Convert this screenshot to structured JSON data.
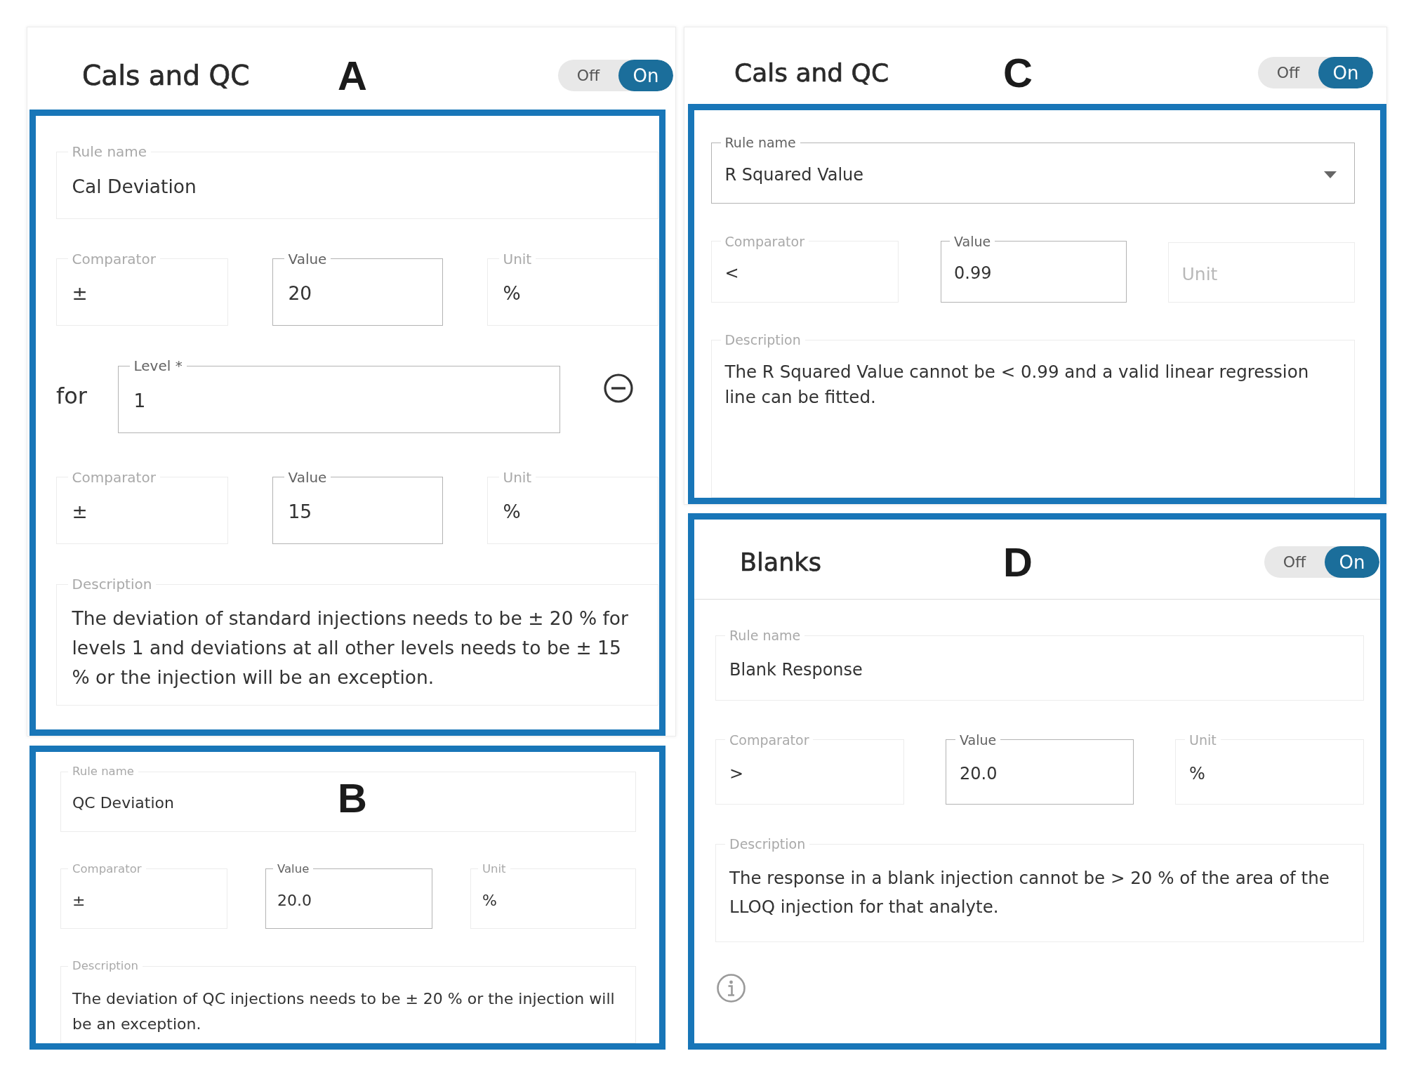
{
  "panels": [
    {
      "letter": "A",
      "kind": "card",
      "title": "Cals and QC",
      "toggle": {
        "off_label": "Off",
        "on_label": "On",
        "on": true
      },
      "rule": {
        "name": {
          "kind": "text",
          "label": "Rule name",
          "value": "Cal Deviation",
          "disabled": true
        },
        "rows": [
          {
            "kind": "condition",
            "fields": [
              {
                "label": "Comparator",
                "value": "±",
                "disabled": true
              },
              {
                "label": "Value",
                "value": "20",
                "disabled": false
              },
              {
                "label": "Unit",
                "value": "%",
                "disabled": true
              }
            ]
          },
          {
            "kind": "level",
            "prefix": "for",
            "removable": true,
            "field": {
              "label": "Level *",
              "value": "1",
              "disabled": false
            }
          },
          {
            "kind": "condition",
            "fields": [
              {
                "label": "Comparator",
                "value": "±",
                "disabled": true
              },
              {
                "label": "Value",
                "value": "15",
                "disabled": false
              },
              {
                "label": "Unit",
                "value": "%",
                "disabled": true
              }
            ]
          }
        ],
        "description": {
          "label": "Description",
          "value": "The deviation of standard injections needs to be ± 20 % for levels 1 and deviations at all other levels needs to be ± 15 % or the injection will be an exception.",
          "disabled": true
        }
      }
    },
    {
      "letter": "B",
      "kind": "card",
      "rule": {
        "name": {
          "kind": "text",
          "label": "Rule name",
          "value": "QC Deviation",
          "disabled": true
        },
        "rows": [
          {
            "kind": "condition",
            "fields": [
              {
                "label": "Comparator",
                "value": "±",
                "disabled": true
              },
              {
                "label": "Value",
                "value": "20.0",
                "disabled": false
              },
              {
                "label": "Unit",
                "value": "%",
                "disabled": true
              }
            ]
          }
        ],
        "description": {
          "label": "Description",
          "value": "The deviation of QC injections needs to be ± 20 % or the injection will be an exception.",
          "disabled": true
        }
      }
    },
    {
      "letter": "C",
      "kind": "card",
      "title": "Cals and QC",
      "toggle": {
        "off_label": "Off",
        "on_label": "On",
        "on": true
      },
      "rule": {
        "name": {
          "kind": "dropdown",
          "label": "Rule name",
          "value": "R Squared Value",
          "disabled": false
        },
        "rows": [
          {
            "kind": "condition",
            "fields": [
              {
                "label": "Comparator",
                "value": "<",
                "disabled": true
              },
              {
                "label": "Value",
                "value": "0.99",
                "disabled": false
              },
              {
                "placeholder": "Unit",
                "disabled": true
              }
            ]
          }
        ],
        "description": {
          "label": "Description",
          "value": "The R Squared Value cannot be < 0.99 and a valid linear regression line can be fitted.",
          "disabled": true
        }
      }
    },
    {
      "letter": "D",
      "kind": "boxed",
      "title": "Blanks",
      "toggle": {
        "off_label": "Off",
        "on_label": "On",
        "on": true
      },
      "rule": {
        "name": {
          "kind": "text",
          "label": "Rule name",
          "value": "Blank Response",
          "disabled": true
        },
        "rows": [
          {
            "kind": "condition",
            "fields": [
              {
                "label": "Comparator",
                "value": ">",
                "disabled": true
              },
              {
                "label": "Value",
                "value": "20.0",
                "disabled": false
              },
              {
                "label": "Unit",
                "value": "%",
                "disabled": true
              }
            ]
          }
        ],
        "description": {
          "label": "Description",
          "value": "The response in a blank injection cannot be > 20 % of the area of the LLOQ injection for that analyte.",
          "disabled": true
        }
      },
      "info_icon": true
    }
  ]
}
